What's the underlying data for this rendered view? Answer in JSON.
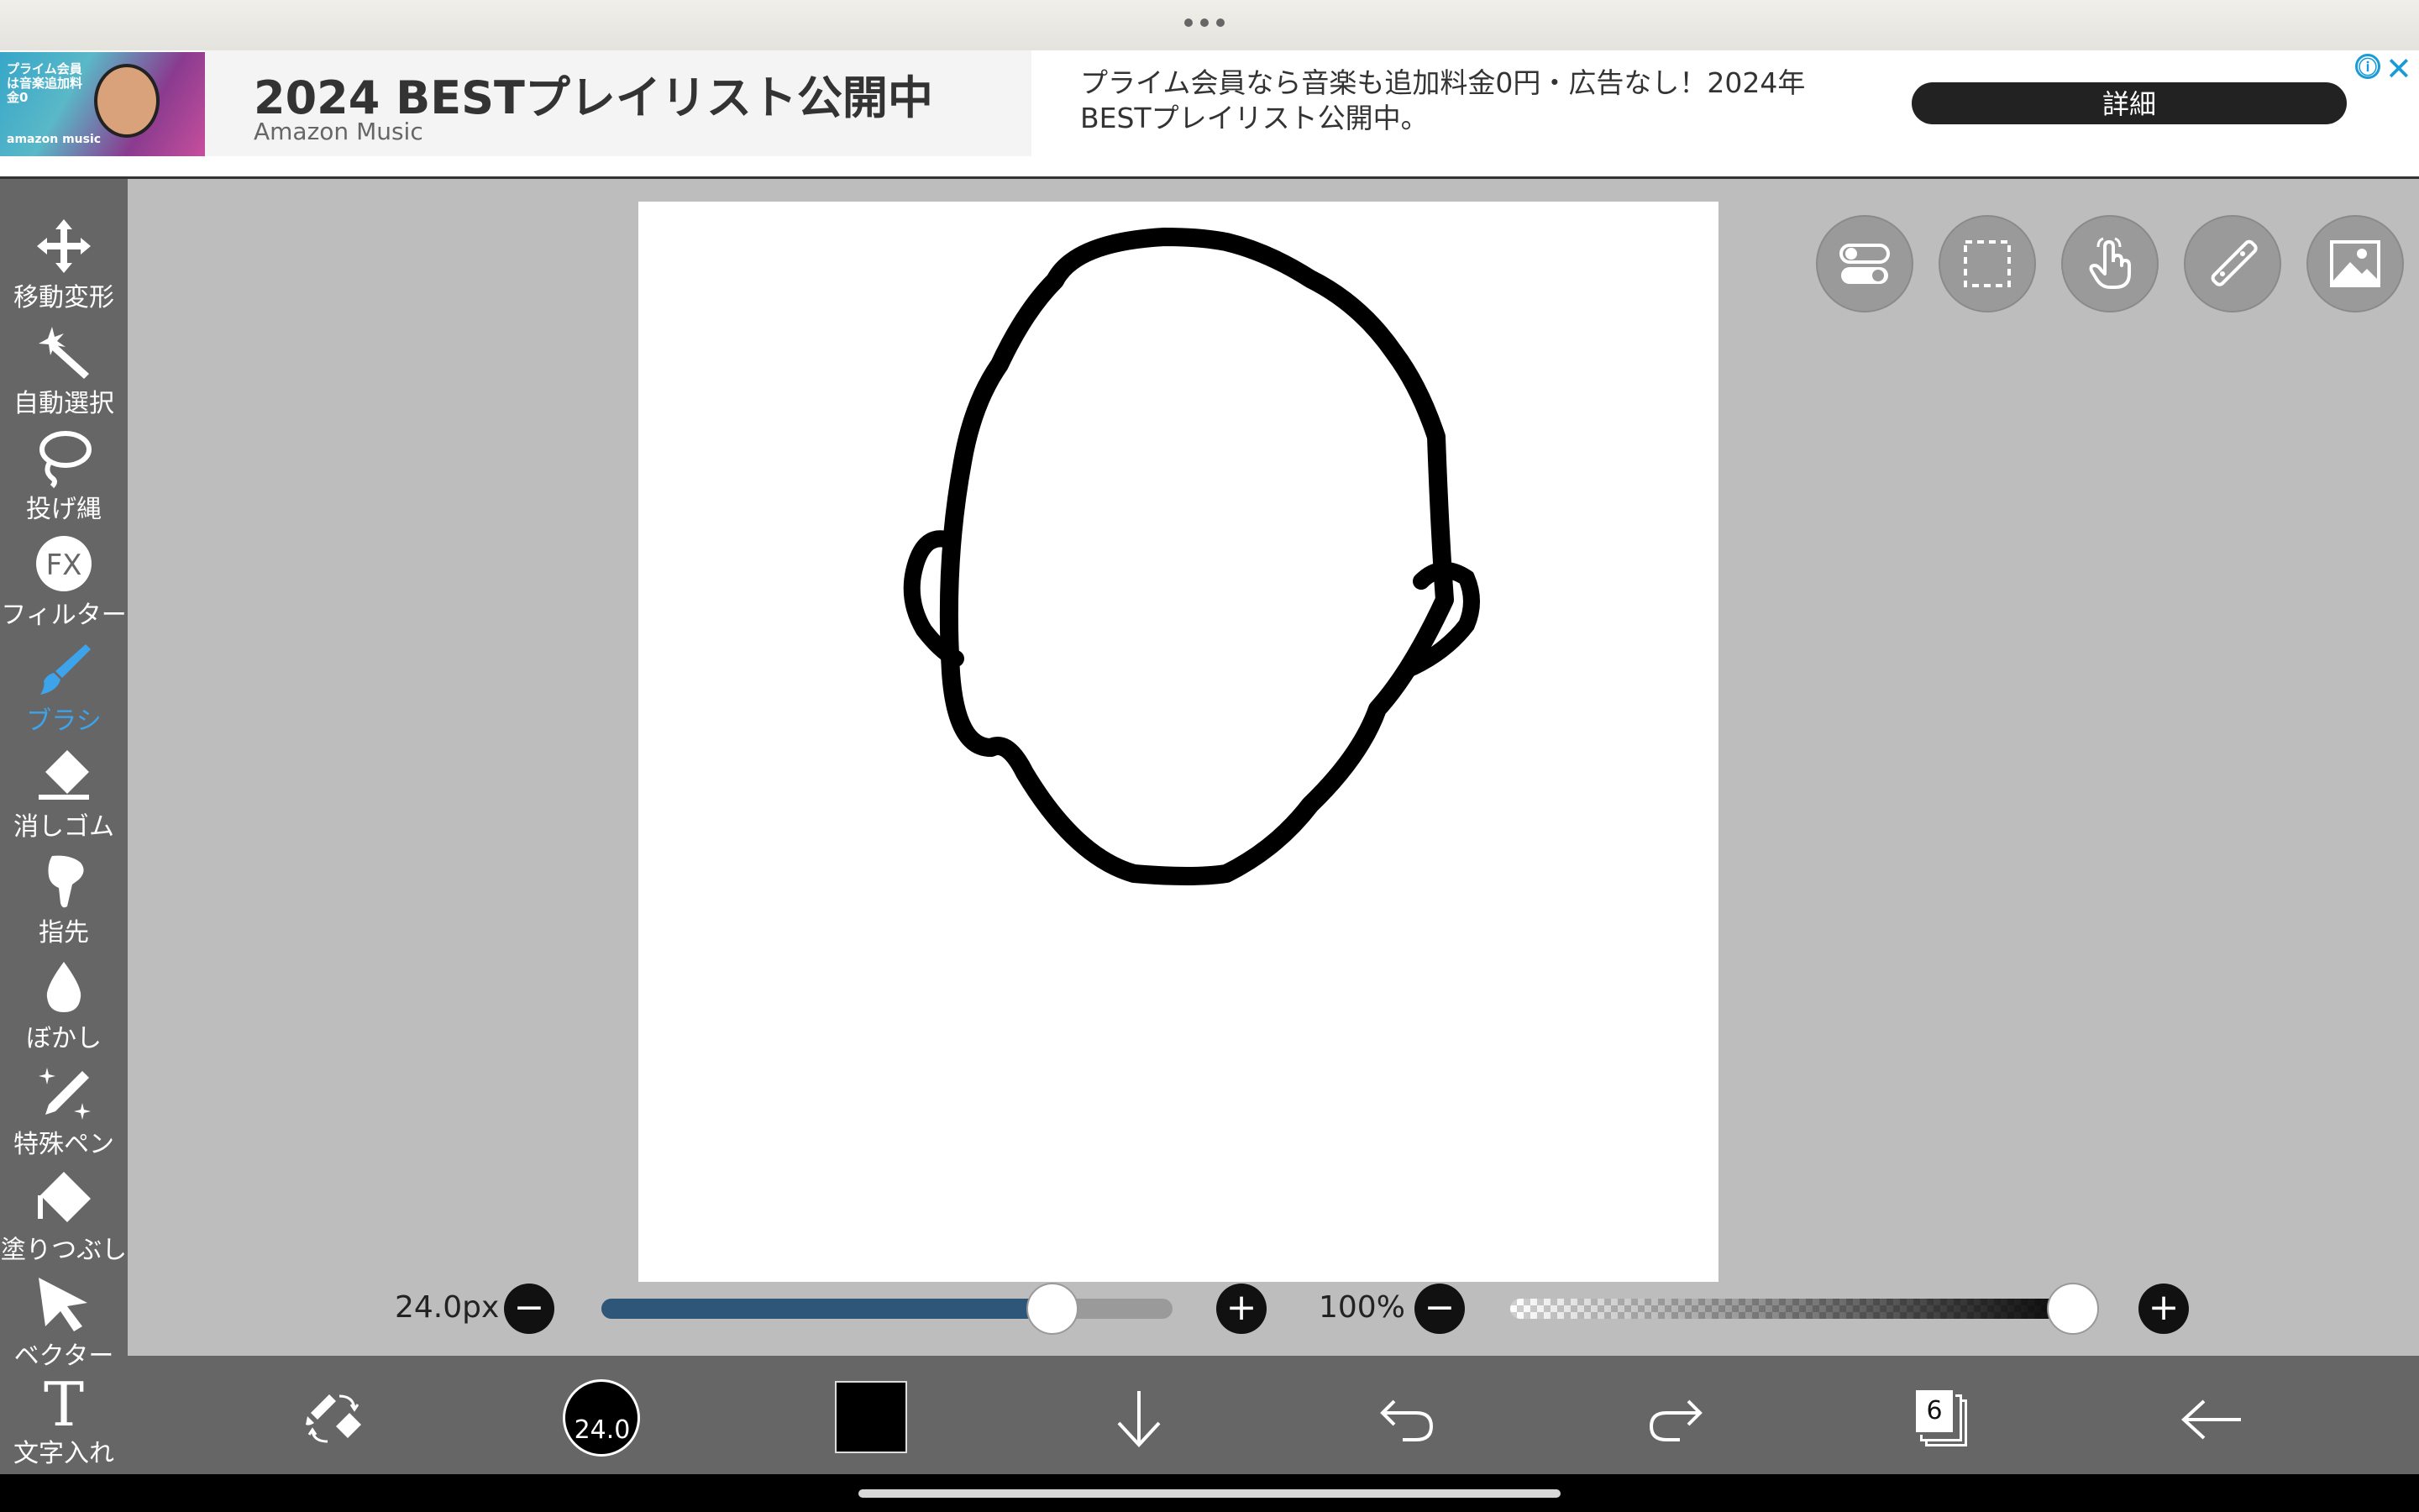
{
  "ad": {
    "thumb_text": "プライム会員は音楽追加料金0",
    "thumb_logo": "amazon music",
    "title": "2024 BESTプレイリスト公開中",
    "advertiser": "Amazon Music",
    "description": "プライム会員なら音楽も追加料金0円・広告なし！2024年BESTプレイリスト公開中。",
    "cta": "詳細",
    "info_icon": "ⓘ",
    "close_icon": "✕"
  },
  "tools": [
    {
      "id": "move",
      "label": "移動変形",
      "icon": "move-icon"
    },
    {
      "id": "autoselect",
      "label": "自動選択",
      "icon": "magic-wand-icon"
    },
    {
      "id": "lasso",
      "label": "投げ縄",
      "icon": "lasso-icon"
    },
    {
      "id": "filter",
      "label": "フィルター",
      "icon": "fx-icon",
      "icon_text": "FX"
    },
    {
      "id": "brush",
      "label": "ブラシ",
      "icon": "brush-icon",
      "active": true
    },
    {
      "id": "eraser",
      "label": "消しゴム",
      "icon": "eraser-icon"
    },
    {
      "id": "finger",
      "label": "指先",
      "icon": "finger-icon"
    },
    {
      "id": "blur",
      "label": "ぼかし",
      "icon": "blur-drop-icon"
    },
    {
      "id": "specialpen",
      "label": "特殊ペン",
      "icon": "special-pen-icon"
    },
    {
      "id": "fill",
      "label": "塗りつぶし",
      "icon": "fill-bucket-icon"
    },
    {
      "id": "vector",
      "label": "ベクター",
      "icon": "vector-arrow-icon"
    },
    {
      "id": "text",
      "label": "文字入れ",
      "icon": "text-icon",
      "icon_text": "T"
    }
  ],
  "sliders": {
    "brush_size_label": "24.0px",
    "brush_size_fraction": 0.79,
    "opacity_label": "100%",
    "opacity_fraction": 1.0,
    "minus": "−",
    "plus": "+"
  },
  "bottom": {
    "brush_size_value": "24.0",
    "current_color": "#000000",
    "layer_count": "6"
  },
  "colors": {
    "accent_active": "#3da4ec",
    "toolbar_bg": "#666666",
    "workspace_bg": "#bdbdbd",
    "slider_fill": "#2e5678"
  }
}
